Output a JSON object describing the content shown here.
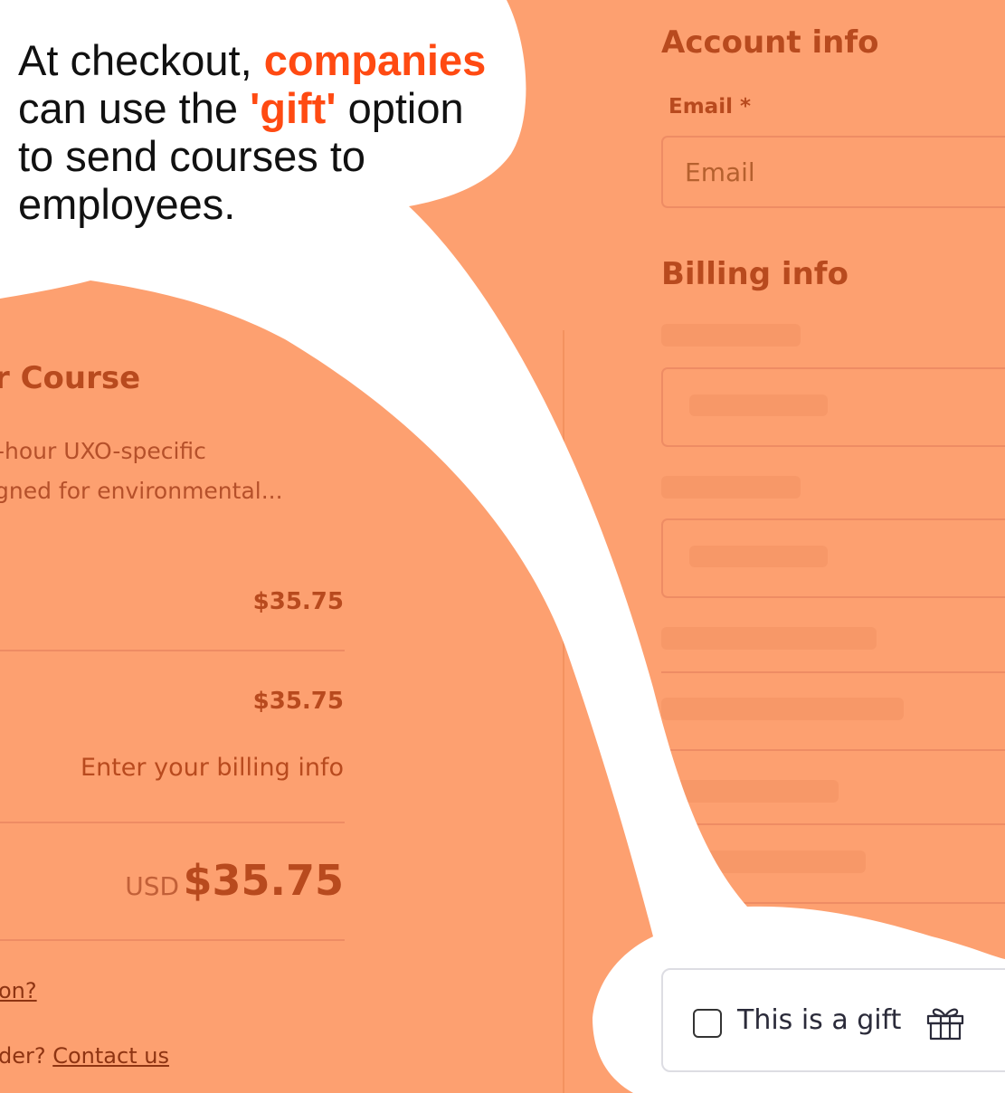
{
  "callout": {
    "line1_pre": "At checkout, ",
    "line1_hl": "companies",
    "line2_pre": "can use the ",
    "line2_hl": "'gift'",
    "line2_post": " option",
    "line3": "to send courses to",
    "line4": "employees."
  },
  "account": {
    "title": "Account info",
    "email_label": "Email *",
    "email_placeholder": "Email"
  },
  "billing": {
    "title": "Billing info"
  },
  "course": {
    "title_fragment": "r Course",
    "desc_line1": "-hour UXO-specific",
    "desc_line2": "gned for environmental..."
  },
  "summary": {
    "price1": "$35.75",
    "price2": "$35.75",
    "billing_prompt": "Enter your billing info",
    "currency": "USD",
    "total": "$35.75",
    "question_link": "on?",
    "contact_pre": "der? ",
    "contact_link": "Contact us"
  },
  "gift": {
    "label": "This is a gift",
    "checked": false,
    "icon": "gift-icon"
  },
  "colors": {
    "overlay": "#FDA070",
    "highlight": "#FF4A12",
    "heading": "#B84A1E"
  }
}
